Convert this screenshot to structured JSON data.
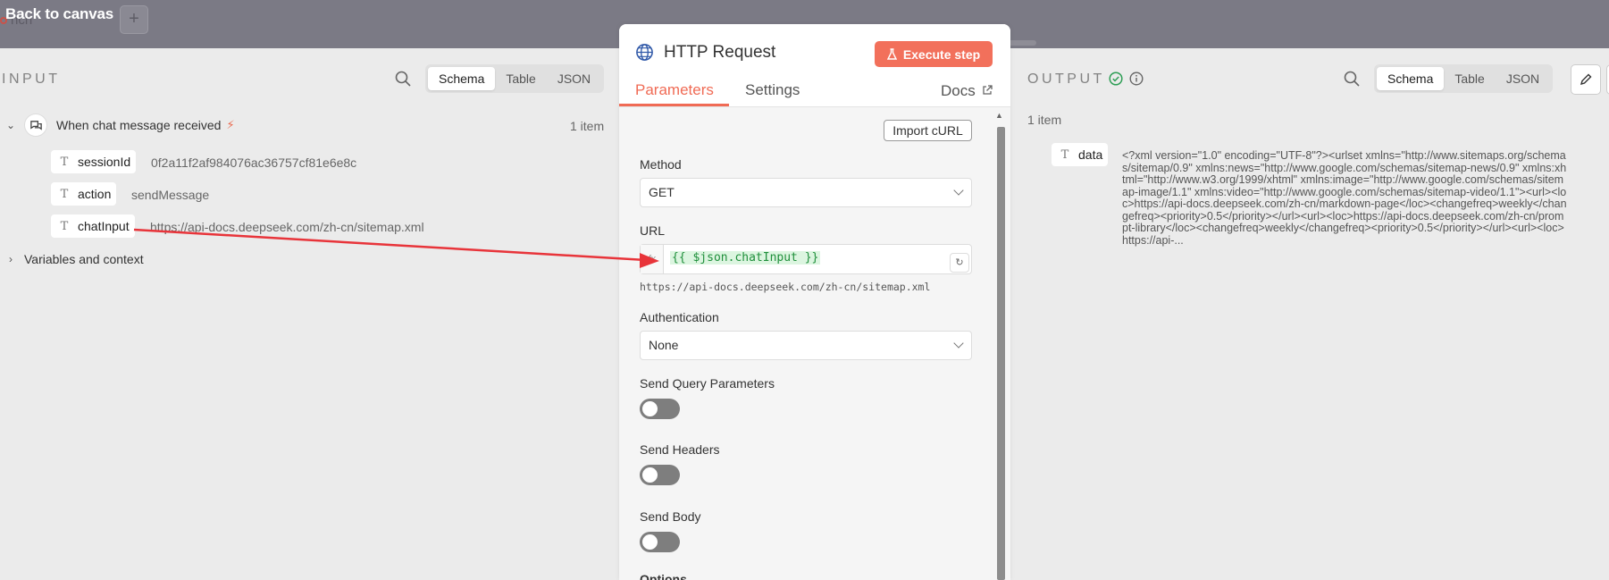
{
  "header": {
    "back_label": "Back to canvas",
    "ghost_tab": "nch",
    "plus": "+"
  },
  "input": {
    "title": "INPUT",
    "views": [
      "Schema",
      "Table",
      "JSON"
    ],
    "active_view": "Schema",
    "node_label": "When chat message received",
    "item_count": "1 item",
    "fields": [
      {
        "name": "sessionId",
        "value": "0f2a11f2af984076ac36757cf81e6e8c"
      },
      {
        "name": "action",
        "value": "sendMessage"
      },
      {
        "name": "chatInput",
        "value": "https://api-docs.deepseek.com/zh-cn/sitemap.xml"
      }
    ],
    "variables_label": "Variables and context"
  },
  "node": {
    "title": "HTTP Request",
    "execute_label": "Execute step",
    "tabs": [
      "Parameters",
      "Settings"
    ],
    "active_tab": "Parameters",
    "docs_label": "Docs",
    "import_label": "Import cURL",
    "method_label": "Method",
    "method_value": "GET",
    "url_label": "URL",
    "url_fx": "fx",
    "url_expression": "{{ $json.chatInput }}",
    "url_resolved": "https://api-docs.deepseek.com/zh-cn/sitemap.xml",
    "auth_label": "Authentication",
    "auth_value": "None",
    "send_query_label": "Send Query Parameters",
    "send_query_enabled": false,
    "send_headers_label": "Send Headers",
    "send_headers_enabled": false,
    "send_body_label": "Send Body",
    "send_body_enabled": false,
    "options_label": "Options"
  },
  "output": {
    "title": "OUTPUT",
    "views": [
      "Schema",
      "Table",
      "JSON"
    ],
    "active_view": "Schema",
    "item_count": "1 item",
    "field_name": "data",
    "field_value": "<?xml version=\"1.0\" encoding=\"UTF-8\"?><urlset xmlns=\"http://www.sitemaps.org/schemas/sitemap/0.9\" xmlns:news=\"http://www.google.com/schemas/sitemap-news/0.9\" xmlns:xhtml=\"http://www.w3.org/1999/xhtml\" xmlns:image=\"http://www.google.com/schemas/sitemap-image/1.1\" xmlns:video=\"http://www.google.com/schemas/sitemap-video/1.1\"><url><loc>https://api-docs.deepseek.com/zh-cn/markdown-page</loc><changefreq>weekly</changefreq><priority>0.5</priority></url><url><loc>https://api-docs.deepseek.com/zh-cn/prompt-library</loc><changefreq>weekly</changefreq><priority>0.5</priority></url><url><loc>https://api-..."
  },
  "colors": {
    "accent": "#f06b55",
    "execute": "#f2705b",
    "arrow": "#e8343a",
    "success": "#2e9e55"
  }
}
